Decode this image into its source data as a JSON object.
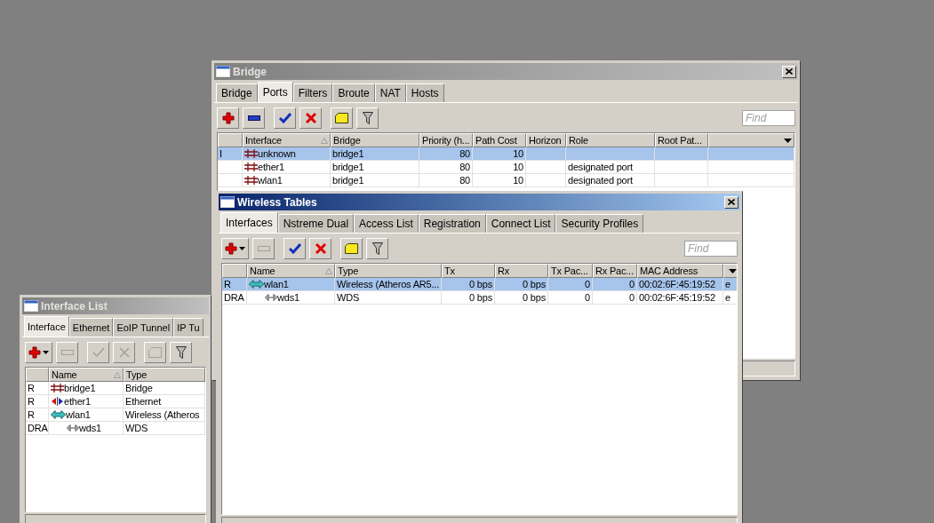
{
  "windows": [
    {
      "title": "Interface List",
      "active": false,
      "tabs": [
        {
          "label": "Interface",
          "selected": true
        },
        {
          "label": "Ethernet",
          "selected": false
        },
        {
          "label": "EoIP Tunnel",
          "selected": false
        },
        {
          "label": "IP Tu",
          "selected": false
        }
      ],
      "toolbar": [
        {
          "kind": "add",
          "dropdown": true,
          "disabled": false
        },
        {
          "kind": "remove",
          "disabled": true
        },
        {
          "kind": "enable",
          "disabled": true
        },
        {
          "kind": "disable",
          "disabled": true
        },
        {
          "kind": "comment",
          "disabled": true
        },
        {
          "kind": "filter",
          "disabled": false
        }
      ],
      "table": {
        "columns": [
          {
            "kind": "flags"
          },
          {
            "kind": "text",
            "label": "Name",
            "sorted": true
          },
          {
            "kind": "text",
            "label": "Type"
          }
        ],
        "rows": [
          {
            "kind": "bridge",
            "selected": false,
            "cells": [
              "R",
              "bridge1",
              "Bridge"
            ]
          },
          {
            "kind": "ethernet",
            "selected": false,
            "cells": [
              "R",
              "ether1",
              "Ethernet"
            ]
          },
          {
            "kind": "wireless",
            "selected": false,
            "cells": [
              "R",
              "wlan1",
              "Wireless (Atheros"
            ],
            "children": [
              {
                "kind": "wds",
                "selected": false,
                "cells": [
                  "DRA",
                  "wds1",
                  "WDS"
                ]
              }
            ]
          }
        ]
      }
    },
    {
      "title": "Bridge",
      "active": false,
      "close_button": true,
      "tabs": [
        {
          "label": "Bridge",
          "selected": false
        },
        {
          "label": "Ports",
          "selected": true
        },
        {
          "label": "Filters",
          "selected": false
        },
        {
          "label": "Broute",
          "selected": false
        },
        {
          "label": "NAT",
          "selected": false
        },
        {
          "label": "Hosts",
          "selected": false
        }
      ],
      "toolbar": [
        {
          "kind": "add",
          "dropdown": false,
          "disabled": false
        },
        {
          "kind": "remove",
          "disabled": false
        },
        {
          "kind": "enable",
          "disabled": false
        },
        {
          "kind": "disable",
          "disabled": false
        },
        {
          "kind": "comment",
          "disabled": false
        },
        {
          "kind": "filter",
          "disabled": false
        }
      ],
      "find": {
        "placeholder": "Find"
      },
      "table": {
        "columns": [
          {
            "kind": "flags"
          },
          {
            "kind": "text",
            "label": "Interface",
            "sorted": true
          },
          {
            "kind": "text",
            "label": "Bridge"
          },
          {
            "kind": "number",
            "label": "Priority (h..."
          },
          {
            "kind": "number",
            "label": "Path Cost"
          },
          {
            "kind": "text",
            "label": "Horizon"
          },
          {
            "kind": "text",
            "label": "Role"
          },
          {
            "kind": "text",
            "label": "Root Pat..."
          },
          {
            "kind": "menu"
          }
        ],
        "rows": [
          {
            "kind": "bridge",
            "selected": true,
            "cells": [
              "I",
              "unknown",
              "bridge1",
              "80",
              "10"
            ]
          },
          {
            "kind": "bridge",
            "selected": false,
            "cells": [
              "",
              "ether1",
              "bridge1",
              "80",
              "10",
              "",
              "designated port"
            ]
          },
          {
            "kind": "bridge",
            "selected": false,
            "cells": [
              "",
              "wlan1",
              "bridge1",
              "80",
              "10",
              "",
              "designated port"
            ]
          }
        ]
      }
    },
    {
      "title": "Wireless Tables",
      "active": true,
      "close_button": true,
      "tabs": [
        {
          "label": "Interfaces",
          "selected": true
        },
        {
          "label": "Nstreme Dual",
          "selected": false
        },
        {
          "label": "Access List",
          "selected": false
        },
        {
          "label": "Registration",
          "selected": false
        },
        {
          "label": "Connect List",
          "selected": false
        },
        {
          "label": "Security Profiles",
          "selected": false
        }
      ],
      "toolbar": [
        {
          "kind": "add",
          "dropdown": true,
          "disabled": false
        },
        {
          "kind": "remove",
          "disabled": true
        },
        {
          "kind": "enable",
          "disabled": false
        },
        {
          "kind": "disable",
          "disabled": false
        },
        {
          "kind": "comment",
          "disabled": false
        },
        {
          "kind": "filter",
          "disabled": false
        }
      ],
      "find": {
        "placeholder": "Find"
      },
      "table": {
        "columns": [
          {
            "kind": "flags"
          },
          {
            "kind": "text",
            "label": "Name",
            "sorted": true
          },
          {
            "kind": "text",
            "label": "Type"
          },
          {
            "kind": "number",
            "label": "Tx"
          },
          {
            "kind": "number",
            "label": "Rx"
          },
          {
            "kind": "number",
            "label": "Tx Pac..."
          },
          {
            "kind": "number",
            "label": "Rx Pac..."
          },
          {
            "kind": "text",
            "label": "MAC Address"
          },
          {
            "kind": "menu"
          }
        ],
        "rows": [
          {
            "kind": "wireless",
            "selected": true,
            "cells": [
              "R",
              "wlan1",
              "Wireless (Atheros AR5...",
              "0 bps",
              "0 bps",
              "0",
              "0",
              "00:02:6F:45:19:52",
              "e"
            ],
            "children": [
              {
                "kind": "wds",
                "selected": false,
                "cells": [
                  "DRA",
                  "wds1",
                  "WDS",
                  "0 bps",
                  "0 bps",
                  "0",
                  "0",
                  "00:02:6F:45:19:52",
                  "e"
                ]
              }
            ]
          }
        ]
      }
    }
  ]
}
